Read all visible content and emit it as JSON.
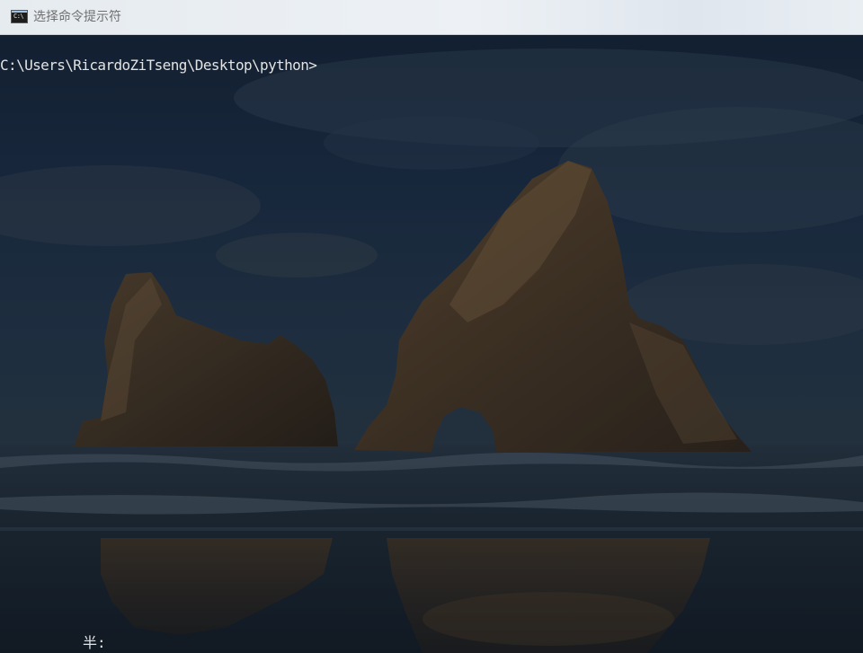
{
  "window": {
    "title": "选择命令提示符",
    "icon": "cmd-icon",
    "icon_text": "C:\\"
  },
  "console": {
    "prompt": "C:\\Users\\RicardoZiTseng\\Desktop\\python>",
    "ime_indicator": "半:",
    "text_color": "#e3e3e3"
  },
  "wallpaper": {
    "description_icon": "beach-rocks-wallpaper",
    "sky_color": "#1e3148",
    "sea_color": "#1c2a35"
  }
}
